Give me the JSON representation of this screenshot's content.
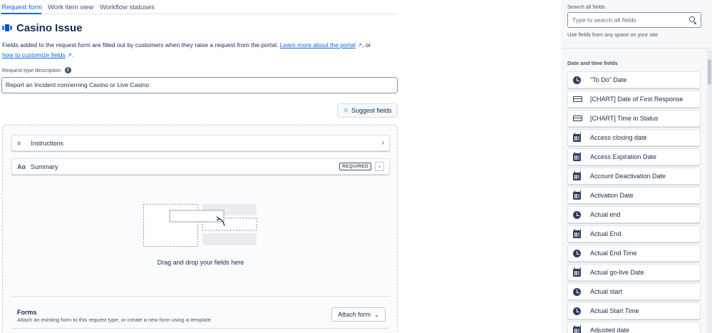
{
  "tabs": [
    {
      "label": "Request form",
      "active": true
    },
    {
      "label": "Work item view",
      "active": false
    },
    {
      "label": "Workflow statuses",
      "active": false
    }
  ],
  "page": {
    "title": "Casino Issue",
    "desc_text": "Fields added to the request form are filled out by customers when they raise a request from the portal. ",
    "desc_link1": "Learn more about the portal",
    "desc_mid": ", or",
    "desc_link2": "how to customize fields",
    "desc_end": "."
  },
  "request_type": {
    "label": "Request type description",
    "value": "Report an Incident concerning Casino or Live Casino"
  },
  "suggest_button": "Suggest fields",
  "form_fields": [
    {
      "lead": "≡",
      "name": "Instructions",
      "icon": "lines-icon"
    },
    {
      "lead": "Aα",
      "name": "Summary",
      "badge": "REQUIRED",
      "icon": "text-icon"
    }
  ],
  "dropzone_text": "Drag and drop your fields here",
  "forms": {
    "title": "Forms",
    "subtitle": "Attach an existing form to this request type, or create a new form using a template.",
    "attach_label": "Attach form"
  },
  "sidebar": {
    "search_label": "Search all fields",
    "search_placeholder": "Type to search all fields",
    "search_help": "Use fields from any space on your site",
    "section_title": "Date and time fields",
    "fields": [
      {
        "label": "\"To Do\" Date",
        "icon": "clock"
      },
      {
        "label": "[CHART] Date of First Response",
        "icon": "box"
      },
      {
        "label": "[CHART] Time in Status",
        "icon": "box"
      },
      {
        "label": "Access closing date",
        "icon": "cal"
      },
      {
        "label": "Access Expiration Date",
        "icon": "cal"
      },
      {
        "label": "Account Deactivation Date",
        "icon": "cal"
      },
      {
        "label": "Activation Date",
        "icon": "cal"
      },
      {
        "label": "Actual end",
        "icon": "clock"
      },
      {
        "label": "Actual End",
        "icon": "cal"
      },
      {
        "label": "Actual End Time",
        "icon": "clock"
      },
      {
        "label": "Actual go-live Date",
        "icon": "cal"
      },
      {
        "label": "Actual start",
        "icon": "clock"
      },
      {
        "label": "Actual Start Time",
        "icon": "clock"
      },
      {
        "label": "Adjusted date",
        "icon": "cal"
      }
    ]
  },
  "colors": {
    "accent": "#0c66e4",
    "text": "#172b4d",
    "subtle": "#44546f"
  }
}
